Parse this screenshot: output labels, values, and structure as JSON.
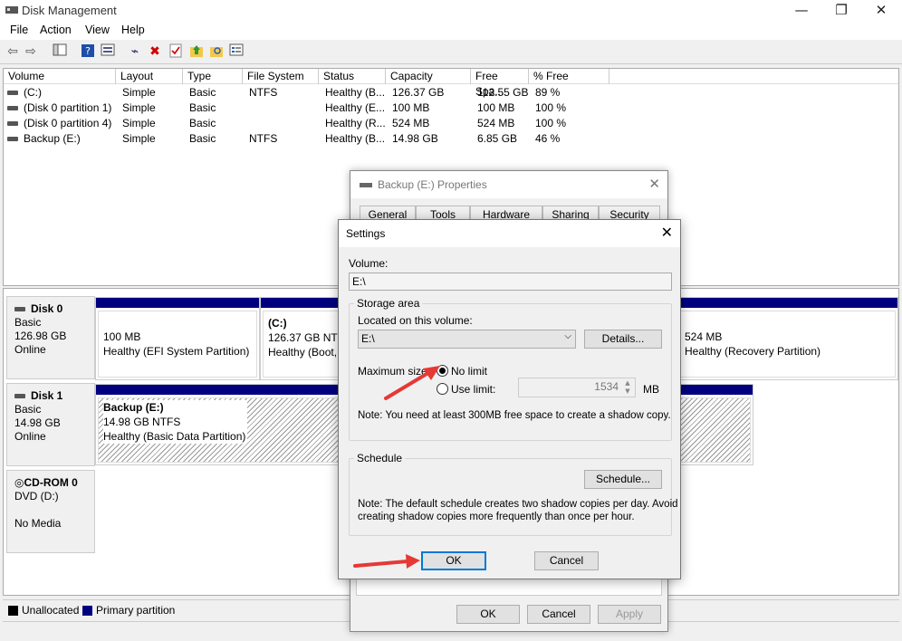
{
  "window": {
    "title": "Disk Management"
  },
  "menu": [
    "File",
    "Action",
    "View",
    "Help"
  ],
  "toolbar_icons": [
    "back-icon",
    "forward-icon",
    "console-tree-icon",
    "help-icon",
    "properties-icon",
    "connect-icon",
    "delete-icon",
    "checkmark-icon",
    "up-folder-icon",
    "search-folder-icon",
    "list-icon"
  ],
  "volumes": {
    "headers": [
      "Volume",
      "Layout",
      "Type",
      "File System",
      "Status",
      "Capacity",
      "Free Spa...",
      "% Free"
    ],
    "rows": [
      [
        "(C:)",
        "Simple",
        "Basic",
        "NTFS",
        "Healthy (B...",
        "126.37 GB",
        "112.55 GB",
        "89 %"
      ],
      [
        "(Disk 0 partition 1)",
        "Simple",
        "Basic",
        "",
        "Healthy (E...",
        "100 MB",
        "100 MB",
        "100 %"
      ],
      [
        "(Disk 0 partition 4)",
        "Simple",
        "Basic",
        "",
        "Healthy (R...",
        "524 MB",
        "524 MB",
        "100 %"
      ],
      [
        "Backup (E:)",
        "Simple",
        "Basic",
        "NTFS",
        "Healthy (B...",
        "14.98 GB",
        "6.85 GB",
        "46 %"
      ]
    ]
  },
  "disks": {
    "disk0": {
      "name": "Disk 0",
      "type": "Basic",
      "size": "126.98 GB",
      "status": "Online",
      "p1": {
        "size": "100 MB",
        "status": "Healthy (EFI System Partition)"
      },
      "p2": {
        "name": "(C:)",
        "size": "126.37 GB NTFS",
        "status": "Healthy (Boot, P"
      },
      "p3": {
        "size": "524 MB",
        "status": "Healthy (Recovery Partition)"
      }
    },
    "disk1": {
      "name": "Disk 1",
      "type": "Basic",
      "size": "14.98 GB",
      "status": "Online",
      "p1": {
        "name": "Backup  (E:)",
        "size": "14.98 GB NTFS",
        "status": "Healthy (Basic Data Partition)"
      }
    },
    "cdrom": {
      "name": "CD-ROM 0",
      "type": "DVD (D:)",
      "status": "No Media"
    }
  },
  "legend": {
    "unallocated": "Unallocated",
    "primary": "Primary partition",
    "unallocated_color": "#000000",
    "primary_color": "#00007f"
  },
  "properties": {
    "title": "Backup (E:) Properties",
    "tabs": [
      "General",
      "Tools",
      "Hardware",
      "Sharing",
      "Security"
    ],
    "ok": "OK",
    "cancel": "Cancel",
    "apply": "Apply"
  },
  "settings": {
    "title": "Settings",
    "volume_label": "Volume:",
    "volume_value": "E:\\",
    "storage_area": "Storage area",
    "located_label": "Located on this volume:",
    "located_value": "E:\\",
    "details": "Details...",
    "max_size_label": "Maximum size:",
    "no_limit": "No limit",
    "use_limit": "Use limit:",
    "limit_value": "1534",
    "limit_unit": "MB",
    "note1": "Note: You need at least 300MB free space to create a shadow copy.",
    "schedule_group": "Schedule",
    "schedule_btn": "Schedule...",
    "note2a": "Note: The default schedule creates two shadow copies per day. Avoid",
    "note2b": "creating shadow copies more frequently than once per hour.",
    "ok": "OK",
    "cancel": "Cancel",
    "selected_option": "No limit"
  }
}
